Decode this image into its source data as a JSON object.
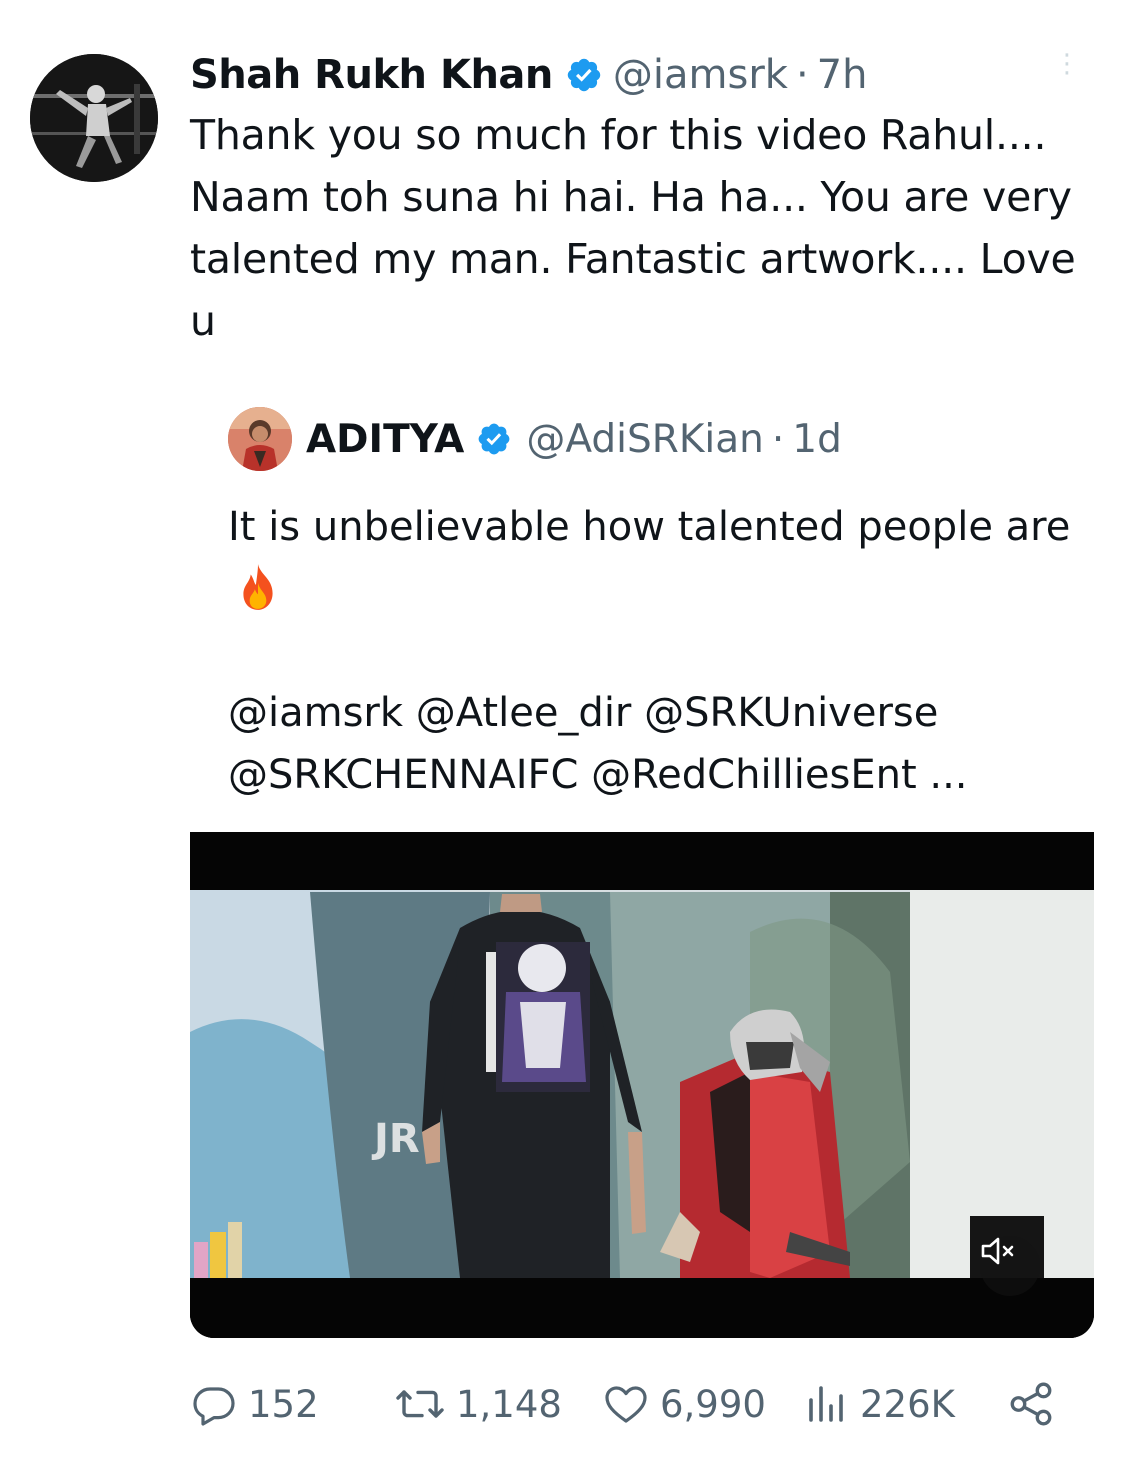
{
  "tweet": {
    "author_name": "Shah Rukh Khan",
    "handle": "@iamsrk",
    "separator": "·",
    "time": "7h",
    "text": "Thank you so much for this video Rahul.... Naam toh suna hi hai. Ha ha... You are very talented my man. Fantastic artwork.... Love u",
    "verified_icon": "verified-badge-icon"
  },
  "quoted_tweet": {
    "author_name": "ADITYA",
    "handle": "@AdiSRKian",
    "separator": "·",
    "time": "1d",
    "text_line1": "It is unbelievable how talented people are",
    "emoji": "fire-emoji",
    "mentions": "@iamsrk @Atlee_dir @SRKUniverse @SRKCHENNAIFC @RedChilliesEnt ...",
    "media_type": "video",
    "media_icon": "muted-speaker-icon"
  },
  "actions": {
    "replies": "152",
    "retweets": "1,148",
    "likes": "6,990",
    "views": "226K"
  },
  "colors": {
    "text": "#0f1419",
    "secondary": "#536471",
    "verified": "#1d9bf0"
  }
}
